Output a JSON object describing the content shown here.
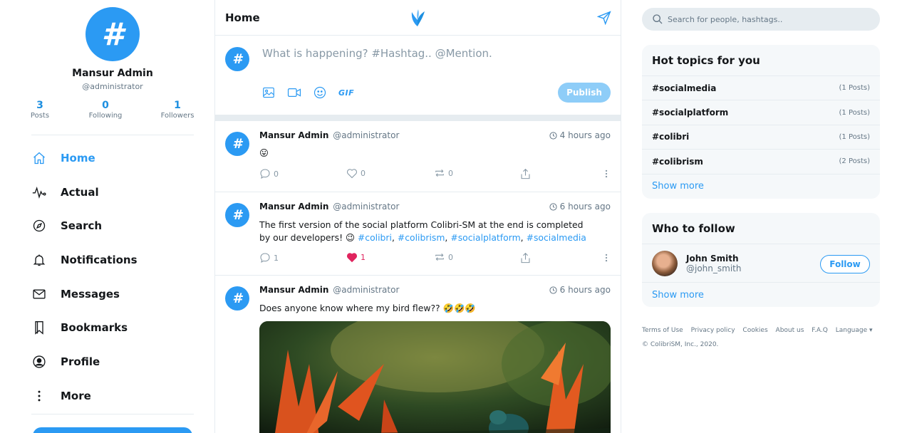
{
  "profile": {
    "avatar_glyph": "#",
    "name": "Mansur Admin",
    "handle": "@administrator",
    "stats": [
      {
        "num": "3",
        "label": "Posts"
      },
      {
        "num": "0",
        "label": "Following"
      },
      {
        "num": "1",
        "label": "Followers"
      }
    ]
  },
  "nav": [
    {
      "label": "Home",
      "icon": "home-icon"
    },
    {
      "label": "Actual",
      "icon": "pulse-icon"
    },
    {
      "label": "Search",
      "icon": "compass-icon"
    },
    {
      "label": "Notifications",
      "icon": "bell-icon"
    },
    {
      "label": "Messages",
      "icon": "mail-icon"
    },
    {
      "label": "Bookmarks",
      "icon": "bookmark-icon"
    },
    {
      "label": "Profile",
      "icon": "user-circle-icon"
    },
    {
      "label": "More",
      "icon": "more-vertical-icon"
    }
  ],
  "header": {
    "title": "Home"
  },
  "compose": {
    "avatar_glyph": "#",
    "placeholder": "What is happening? #Hashtag.. @Mention.",
    "gif_label": "GIF",
    "publish_label": "Publish"
  },
  "posts": [
    {
      "author": "Mansur Admin",
      "handle": "@administrator",
      "time": "4 hours ago",
      "text": "😛",
      "replies": "0",
      "likes": "0",
      "reposts": "0"
    },
    {
      "author": "Mansur Admin",
      "handle": "@administrator",
      "time": "6 hours ago",
      "text_pre": "The first version of the social platform Colibri-SM at the end is completed by our developers! 😉 ",
      "tags": [
        "#colibri",
        "#colibrism",
        "#socialplatform",
        "#socialmedia"
      ],
      "replies": "1",
      "likes": "1",
      "reposts": "0"
    },
    {
      "author": "Mansur Admin",
      "handle": "@administrator",
      "time": "6 hours ago",
      "text": "Does anyone know where my bird flew?? 🤣🤣🤣"
    }
  ],
  "search": {
    "placeholder": "Search for people, hashtags.."
  },
  "hot_topics": {
    "title": "Hot topics for you",
    "items": [
      {
        "tag": "#socialmedia",
        "count": "(1 Posts)"
      },
      {
        "tag": "#socialplatform",
        "count": "(1 Posts)"
      },
      {
        "tag": "#colibri",
        "count": "(1 Posts)"
      },
      {
        "tag": "#colibrism",
        "count": "(2 Posts)"
      }
    ],
    "show_more": "Show more"
  },
  "who_to_follow": {
    "title": "Who to follow",
    "users": [
      {
        "name": "John Smith",
        "handle": "@john_smith",
        "button": "Follow"
      }
    ],
    "show_more": "Show more"
  },
  "footer": {
    "links": [
      "Terms of Use",
      "Privacy policy",
      "Cookies",
      "About us",
      "F.A.Q",
      "Language ▾"
    ],
    "copyright": "© ColibriSM, Inc., 2020."
  },
  "colors": {
    "accent": "#2b9af3",
    "like": "#e0245e",
    "muted": "#657786",
    "divider": "#e6ecf0"
  }
}
